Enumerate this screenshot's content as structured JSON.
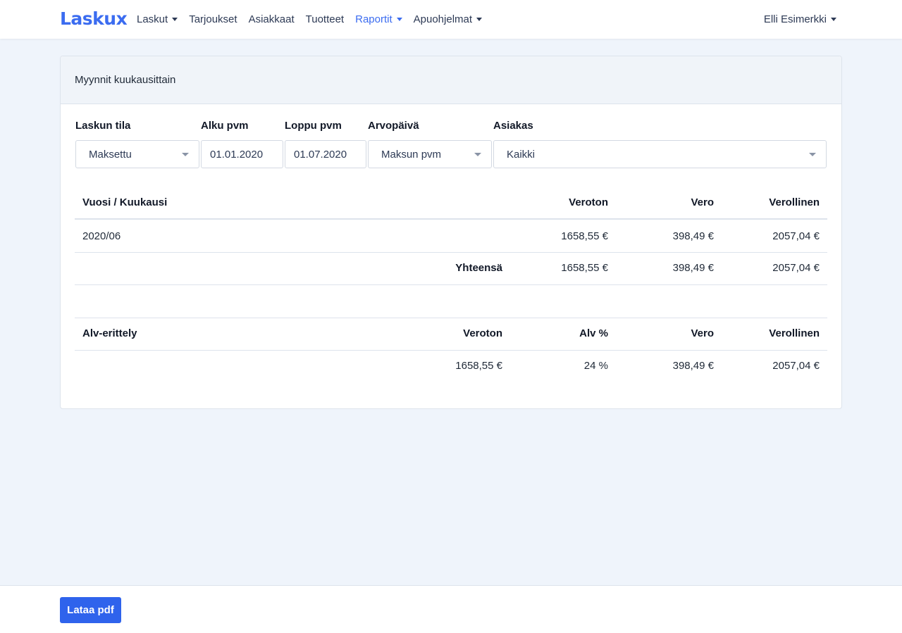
{
  "navbar": {
    "logo": "Laskux",
    "items": [
      {
        "label": "Laskut",
        "dropdown": true
      },
      {
        "label": "Tarjoukset",
        "dropdown": false
      },
      {
        "label": "Asiakkaat",
        "dropdown": false
      },
      {
        "label": "Tuotteet",
        "dropdown": false
      },
      {
        "label": "Raportit",
        "dropdown": true,
        "active": true
      },
      {
        "label": "Apuohjelmat",
        "dropdown": true
      }
    ],
    "user": "Elli Esimerkki"
  },
  "card": {
    "title": "Myynnit kuukausittain"
  },
  "filters": {
    "status": {
      "label": "Laskun tila",
      "value": "Maksettu"
    },
    "start": {
      "label": "Alku pvm",
      "value": "01.01.2020"
    },
    "end": {
      "label": "Loppu pvm",
      "value": "01.07.2020"
    },
    "value_date": {
      "label": "Arvopäivä",
      "value": "Maksun pvm"
    },
    "customer": {
      "label": "Asiakas",
      "value": "Kaikki"
    }
  },
  "monthly_table": {
    "headers": {
      "period": "Vuosi / Kuukausi",
      "net": "Veroton",
      "tax": "Vero",
      "gross": "Verollinen"
    },
    "rows": [
      {
        "period": "2020/06",
        "net": "1658,55 €",
        "tax": "398,49 €",
        "gross": "2057,04 €"
      }
    ],
    "total": {
      "label": "Yhteensä",
      "net": "1658,55 €",
      "tax": "398,49 €",
      "gross": "2057,04 €"
    }
  },
  "vat_table": {
    "headers": {
      "title": "Alv-erittely",
      "net": "Veroton",
      "rate": "Alv %",
      "tax": "Vero",
      "gross": "Verollinen"
    },
    "rows": [
      {
        "net": "1658,55 €",
        "rate": "24 %",
        "tax": "398,49 €",
        "gross": "2057,04 €"
      }
    ]
  },
  "footer": {
    "pdf_button": "Lataa pdf"
  },
  "colors": {
    "accent": "#2f63ec",
    "background": "#eff4fb"
  }
}
